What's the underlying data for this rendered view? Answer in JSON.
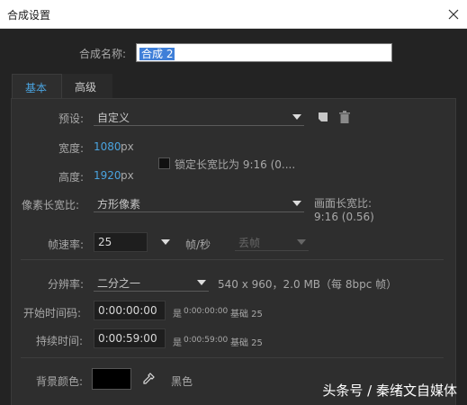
{
  "window": {
    "title": "合成设置"
  },
  "name": {
    "label": "合成名称:",
    "value": "合成 2"
  },
  "tabs": [
    {
      "label": "基本"
    },
    {
      "label": "高级"
    }
  ],
  "preset": {
    "label": "预设:",
    "value": "自定义"
  },
  "width": {
    "label": "宽度:",
    "value": "1080",
    "unit": "px"
  },
  "height": {
    "label": "高度:",
    "value": "1920",
    "unit": "px"
  },
  "lock_aspect": {
    "label": "锁定长宽比为 9:16 (0....",
    "checked": false
  },
  "pixel_aspect": {
    "label": "像素长宽比:",
    "value": "方形像素"
  },
  "frame_aspect": {
    "label": "画面长宽比:",
    "value": "9:16 (0.56)"
  },
  "frame_rate": {
    "label": "帧速率:",
    "value": "25",
    "unit": "帧/秒",
    "drop_frame": "丢帧"
  },
  "resolution": {
    "label": "分辨率:",
    "value": "二分之一",
    "info": "540 x 960，2.0 MB（每 8bpc 帧）"
  },
  "start_timecode": {
    "label": "开始时间码:",
    "value": "0:00:00:00",
    "note_is": "是",
    "note_value": "0:00:00:00",
    "note_base": "基础 25"
  },
  "duration": {
    "label": "持续时间:",
    "value": "0:00:59:00",
    "note_is": "是",
    "note_value": "0:00:59:00",
    "note_base": "基础 25"
  },
  "background": {
    "label": "背景颜色:",
    "color": "#000000",
    "color_name": "黑色"
  },
  "watermark": "头条号 / 秦绪文自媒体",
  "colors": {
    "accent": "#4aa3df",
    "panel": "#2e2e2e",
    "window": "#232323"
  }
}
